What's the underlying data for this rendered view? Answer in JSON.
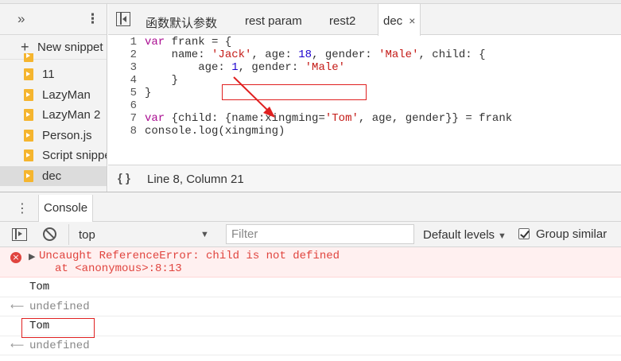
{
  "navigator": {
    "more_tabs": "»",
    "menu": "⋮",
    "new_snippet": "New snippet",
    "snippets": [
      {
        "name": ""
      },
      {
        "name": "11"
      },
      {
        "name": "LazyMan"
      },
      {
        "name": "LazyMan 2"
      },
      {
        "name": "Person.js"
      },
      {
        "name": "Script snippet"
      },
      {
        "name": "dec"
      }
    ],
    "selected": "dec"
  },
  "editor": {
    "tabs": [
      "函数默认参数",
      "rest param",
      "rest2",
      "dec"
    ],
    "active_tab": "dec",
    "close_glyph": "×",
    "lines": [
      "1",
      "2",
      "3",
      "4",
      "5",
      "6",
      "7",
      "8"
    ],
    "highlight": "{name:xingming='Tom',",
    "status": {
      "braces": "{ }",
      "position": "Line 8, Column 21"
    }
  },
  "drawer": {
    "more": "⋮",
    "tab": "Console"
  },
  "console_toolbar": {
    "context": "top",
    "filter_placeholder": "Filter",
    "levels": "Default levels",
    "group_similar": "Group similar",
    "group_similar_checked": true
  },
  "console": {
    "error_line1": "Uncaught ReferenceError: child is not defined",
    "error_line2": "at <anonymous>:8:13",
    "log1": "Tom",
    "result1": "undefined",
    "log2": "Tom",
    "result2": "undefined"
  },
  "colors": {
    "error": "#e0443e",
    "annotation": "#e02020",
    "file_icon": "#f5b52e"
  }
}
